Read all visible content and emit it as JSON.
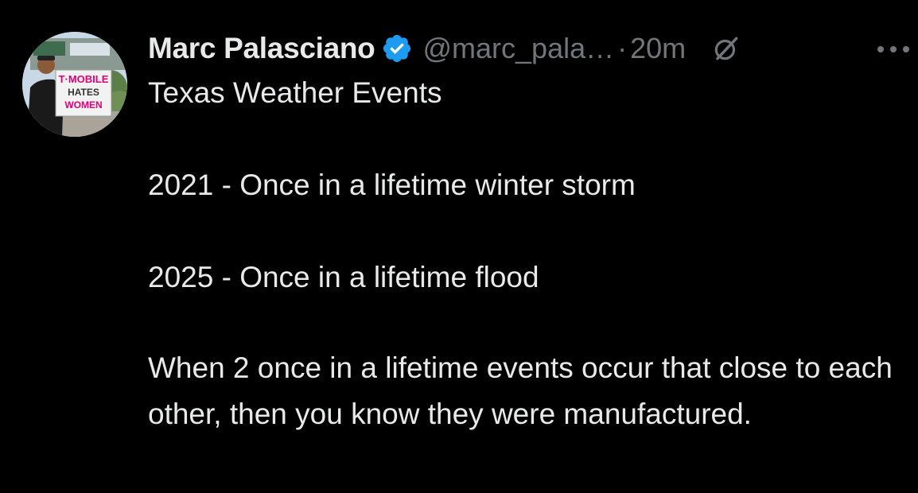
{
  "tweet": {
    "author": {
      "display_name": "Marc Palasciano",
      "handle": "@marc_pala…",
      "verified": true,
      "avatar_sign_text": [
        "T·MOBILE",
        "HATES",
        "WOMEN"
      ]
    },
    "separator": "·",
    "timestamp": "20m",
    "body": {
      "title": "Texas Weather Events",
      "line1": "2021 - Once in a lifetime winter storm",
      "line2": "2025 - Once in a lifetime flood",
      "line3": "When 2 once in a lifetime events occur that close to each other, then you know they were manufactured."
    },
    "icons": {
      "verified": "verified-badge-icon",
      "grok": "grok-icon",
      "more": "more-options-icon"
    },
    "colors": {
      "background": "#000000",
      "text": "#e7e9ea",
      "secondary_text": "#71767b",
      "verified_blue": "#1d9bf0"
    }
  }
}
